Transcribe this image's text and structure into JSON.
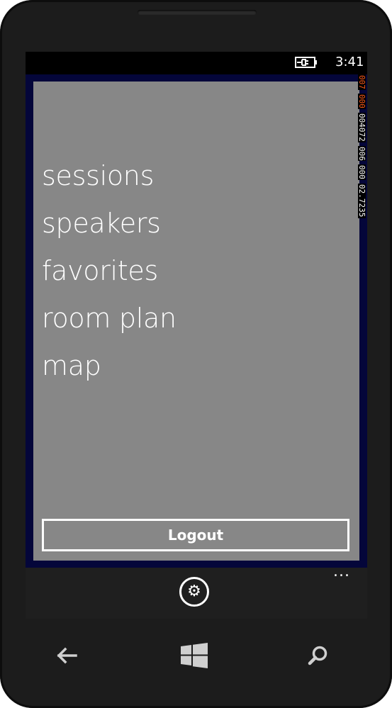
{
  "status_bar": {
    "time": "3:41",
    "battery_icon": "battery-charging-icon"
  },
  "debug_counters": [
    {
      "text": "007",
      "color": "#ff5a1a"
    },
    {
      "text": "000",
      "color": "#ff5a1a"
    },
    {
      "text": "004072",
      "color": "#ffffff"
    },
    {
      "text": "006",
      "color": "#ffffff"
    },
    {
      "text": "000",
      "color": "#ffffff"
    },
    {
      "text": "02.7235",
      "color": "#ffffff"
    }
  ],
  "menu": {
    "items": [
      {
        "label": "sessions"
      },
      {
        "label": "speakers"
      },
      {
        "label": "favorites"
      },
      {
        "label": "room plan"
      },
      {
        "label": "map"
      }
    ]
  },
  "logout_label": "Logout",
  "app_bar": {
    "settings_icon": "gear-icon",
    "more_icon": "ellipsis-icon",
    "more_label": "..."
  },
  "hardware_buttons": {
    "back_icon": "back-arrow-icon",
    "start_icon": "windows-logo-icon",
    "search_icon": "search-icon"
  },
  "colors": {
    "app_background": "#04063a",
    "content_background": "#878787",
    "phone_body": "#1c1c1c",
    "counter_accent": "#ff5a1a"
  }
}
